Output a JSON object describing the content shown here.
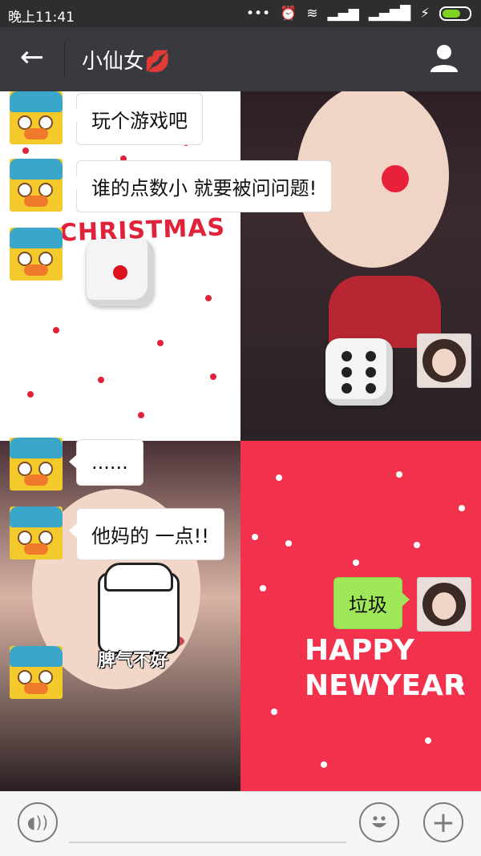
{
  "status_bar": {
    "time": "晚上11:41"
  },
  "header": {
    "title": "小仙女",
    "title_emoji": "💋"
  },
  "chat": {
    "messages": [
      {
        "side": "left",
        "text": "玩个游戏吧"
      },
      {
        "side": "left",
        "text": "谁的点数小 就要被问问题!"
      },
      {
        "side": "left",
        "type": "dice",
        "value": 1
      },
      {
        "side": "right",
        "type": "dice",
        "value": 6
      },
      {
        "side": "left",
        "text": "......"
      },
      {
        "side": "left",
        "text": "他妈的 一点!!"
      },
      {
        "side": "right",
        "text": "垃圾"
      },
      {
        "side": "left",
        "type": "sticker",
        "caption": "脾气不好"
      }
    ],
    "background_texts": {
      "christmas": "CHRISTMAS",
      "happy_new_year_1": "HAPPY",
      "happy_new_year_2": "NEWYEAR"
    }
  },
  "icons": {
    "back": "back-arrow-icon",
    "profile": "person-icon",
    "voice": "voice-icon",
    "emoji": "emoji-icon",
    "plus": "plus-icon"
  },
  "colors": {
    "header_bg": "#393a3f",
    "sent_bubble": "#9fe658",
    "red_panel": "#f2314d"
  }
}
